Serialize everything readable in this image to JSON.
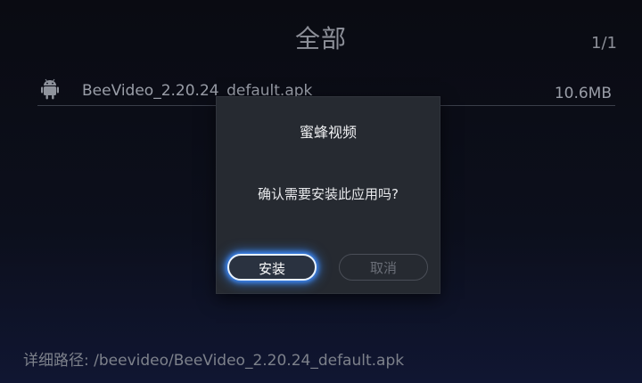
{
  "header": {
    "title": "全部",
    "page_counter": "1/1"
  },
  "file_list": [
    {
      "icon": "android-icon",
      "name": "BeeVideo_2.20.24_default.apk",
      "size": "10.6MB"
    }
  ],
  "dialog": {
    "title": "蜜蜂视频",
    "message": "确认需要安装此应用吗?",
    "install_label": "安装",
    "cancel_label": "取消"
  },
  "footer": {
    "detail_path": "详细路径: /beevideo/BeeVideo_2.20.24_default.apk"
  },
  "colors": {
    "focus_glow": "#3d8cff",
    "dialog_bg": "#262a31",
    "background": "#0a0b12"
  }
}
